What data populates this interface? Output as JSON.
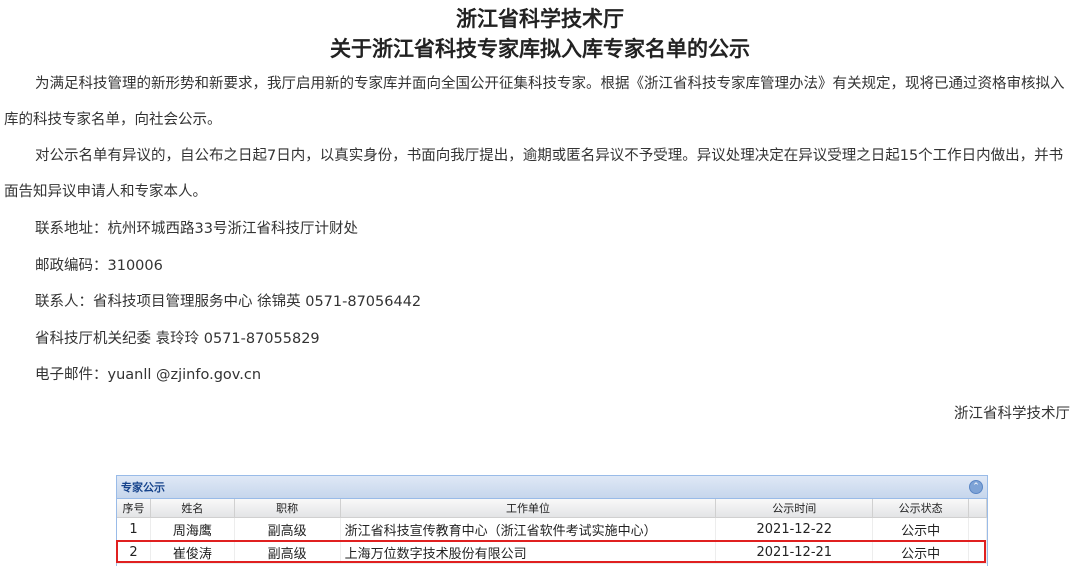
{
  "title1": "浙江省科学技术厅",
  "title2": "关于浙江省科技专家库拟入库专家名单的公示",
  "para1": "为满足科技管理的新形势和新要求，我厅启用新的专家库并面向全国公开征集科技专家。根据《浙江省科技专家库管理办法》有关规定，现将已通过资格审核拟入库的科技专家名单，向社会公示。",
  "para2": "对公示名单有异议的，自公布之日起7日内，以真实身份，书面向我厅提出，逾期或匿名异议不予受理。异议处理决定在异议受理之日起15个工作日内做出，并书面告知异议申请人和专家本人。",
  "contact": {
    "address": "联系地址：杭州环城西路33号浙江省科技厅计财处",
    "postcode": "邮政编码：310006",
    "person": "联系人：省科技项目管理服务中心 徐锦英 0571-87056442",
    "discipline": "省科技厅机关纪委 袁玲玲 0571-87055829",
    "email": "电子邮件：yuanll @zjinfo.gov.cn"
  },
  "signature": "浙江省科学技术厅",
  "panel": {
    "title": "专家公示",
    "columns": [
      "序号",
      "姓名",
      "职称",
      "工作单位",
      "公示时间",
      "公示状态"
    ],
    "rows": [
      [
        "1",
        "周海鹰",
        "副高级",
        "浙江省科技宣传教育中心（浙江省软件考试实施中心）",
        "2021-12-22",
        "公示中"
      ],
      [
        "2",
        "崔俊涛",
        "副高级",
        "上海万位数字技术股份有限公司",
        "2021-12-21",
        "公示中"
      ]
    ]
  }
}
